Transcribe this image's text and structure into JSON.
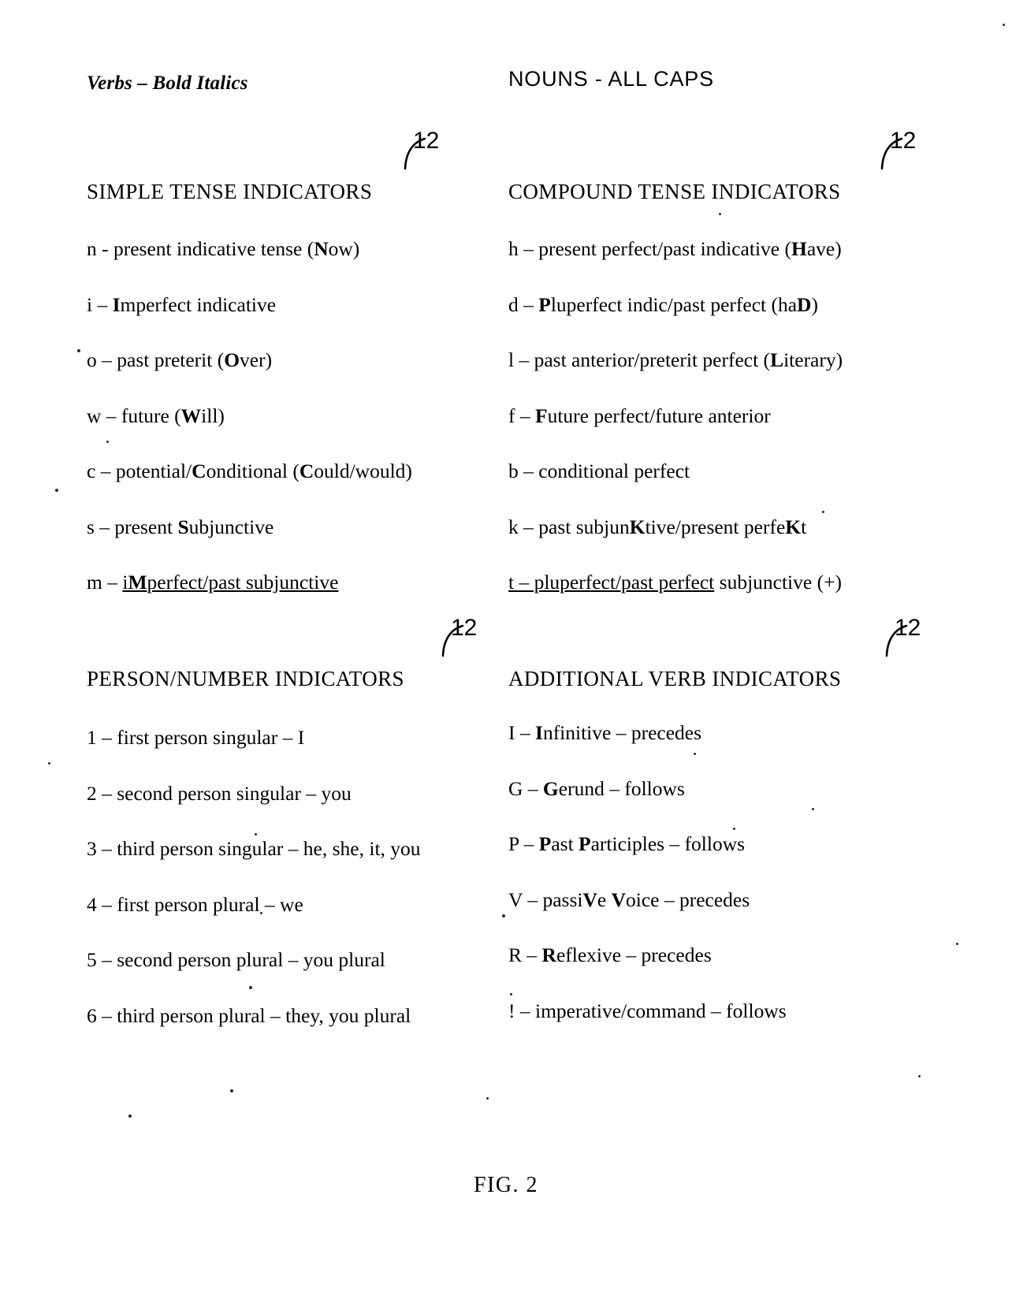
{
  "figure": {
    "caption": "FIG.  2",
    "reference_numeral": "12"
  },
  "legend": {
    "verbs": "Verbs – Bold Italics",
    "nouns": "NOUNS - ALL CAPS"
  },
  "sections": {
    "simple_tense": {
      "title": "SIMPLE TENSE INDICATORS",
      "ref": "12",
      "items": [
        "n - present indicative tense (Now)",
        "i – Imperfect indicative",
        "o – past preterit (Over)",
        "w – future (Will)",
        "c – potential/Conditional (Could/would)",
        "s – present Subjunctive",
        "m – iMperfect/past subjunctive"
      ]
    },
    "compound_tense": {
      "title": "COMPOUND TENSE INDICATORS",
      "ref": "12",
      "items": [
        "h – present perfect/past indicative (Have)",
        "d – Pluperfect indic/past perfect (haD)",
        "l – past anterior/preterit perfect (Literary)",
        "f – Future perfect/future anterior",
        "b – conditional perfect",
        "k – past subjunKtive/present perfeKt",
        "t – pluperfect/past perfect subjunctive (+)"
      ]
    },
    "person_number": {
      "title": "PERSON/NUMBER INDICATORS",
      "ref": "12",
      "items": [
        "1 – first person singular – I",
        "2 – second person singular – you",
        "3 – third person singular – he, she, it, you",
        "4 – first person plural – we",
        "5 – second person plural – you plural",
        "6 – third person plural – they, you plural"
      ]
    },
    "additional_verb": {
      "title": "ADDITIONAL VERB INDICATORS",
      "ref": "12",
      "items": [
        "I – Infinitive – precedes",
        "G – Gerund – follows",
        "P – Past Participles – follows",
        "V – passiVe Voice – precedes",
        "R – Reflexive – precedes",
        "! – imperative/command – follows"
      ]
    }
  }
}
